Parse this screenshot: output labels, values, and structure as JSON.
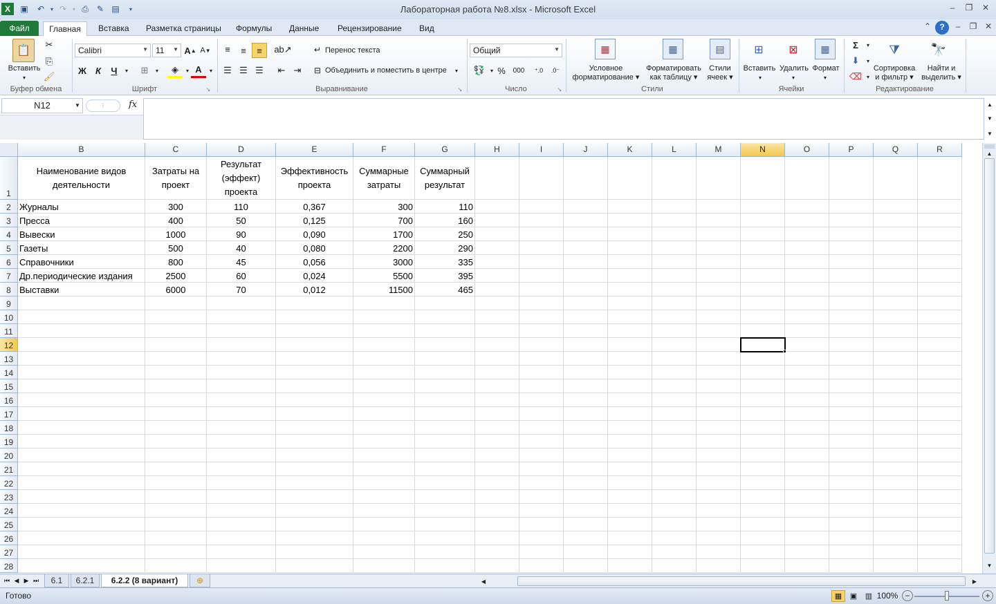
{
  "window": {
    "title": "Лабораторная работа №8.xlsx  -  Microsoft Excel"
  },
  "tabs": [
    "Файл",
    "Главная",
    "Вставка",
    "Разметка страницы",
    "Формулы",
    "Данные",
    "Рецензирование",
    "Вид"
  ],
  "ribbon": {
    "clipboard": {
      "paste": "Вставить",
      "label": "Буфер обмена"
    },
    "font": {
      "name": "Calibri",
      "size": "11",
      "bold": "Ж",
      "italic": "К",
      "underline": "Ч",
      "label": "Шрифт"
    },
    "alignment": {
      "wrap": "Перенос текста",
      "merge": "Объединить и поместить в центре",
      "label": "Выравнивание"
    },
    "number": {
      "format": "Общий",
      "percent": "%",
      "thousands": "000",
      "label": "Число"
    },
    "styles": {
      "conditional1": "Условное",
      "conditional2": "форматирование",
      "astable1": "Форматировать",
      "astable2": "как таблицу",
      "cellstyles1": "Стили",
      "cellstyles2": "ячеек",
      "label": "Стили"
    },
    "cells": {
      "insert": "Вставить",
      "delete": "Удалить",
      "format": "Формат",
      "label": "Ячейки"
    },
    "editing": {
      "sort1": "Сортировка",
      "sort2": "и фильтр",
      "find1": "Найти и",
      "find2": "выделить",
      "label": "Редактирование"
    }
  },
  "formula_bar": {
    "name_box": "N12",
    "fx": "fx",
    "value": ""
  },
  "columns": [
    "B",
    "C",
    "D",
    "E",
    "F",
    "G",
    "H",
    "I",
    "J",
    "K",
    "L",
    "M",
    "N",
    "O",
    "P",
    "Q",
    "R"
  ],
  "rows": [
    "1",
    "2",
    "3",
    "4",
    "5",
    "6",
    "7",
    "8",
    "9",
    "10",
    "11",
    "12",
    "13",
    "14",
    "15",
    "16",
    "17",
    "18",
    "19",
    "20",
    "21",
    "22",
    "23",
    "24",
    "25",
    "26",
    "27",
    "28"
  ],
  "selected": {
    "cell": "N12",
    "column": "N",
    "row": "12"
  },
  "table": {
    "headers": [
      "Наименование видов деятельности",
      "Затраты на проект",
      "Результат (эффект) проекта",
      "Эффективность проекта",
      "Суммарные затраты",
      "Суммарный результат"
    ],
    "rows": [
      [
        "Журналы",
        "300",
        "110",
        "0,367",
        "300",
        "110"
      ],
      [
        "Пресса",
        "400",
        "50",
        "0,125",
        "700",
        "160"
      ],
      [
        "Вывески",
        "1000",
        "90",
        "0,090",
        "1700",
        "250"
      ],
      [
        "Газеты",
        "500",
        "40",
        "0,080",
        "2200",
        "290"
      ],
      [
        "Справочники",
        "800",
        "45",
        "0,056",
        "3000",
        "335"
      ],
      [
        "Др.периодические издания",
        "2500",
        "60",
        "0,024",
        "5500",
        "395"
      ],
      [
        "Выставки",
        "6000",
        "70",
        "0,012",
        "11500",
        "465"
      ]
    ]
  },
  "sheets": [
    "6.1",
    "6.2.1",
    "6.2.2 (8 вариант)"
  ],
  "active_sheet": "6.2.2 (8 вариант)",
  "status": {
    "text": "Готово",
    "zoom": "100%"
  }
}
